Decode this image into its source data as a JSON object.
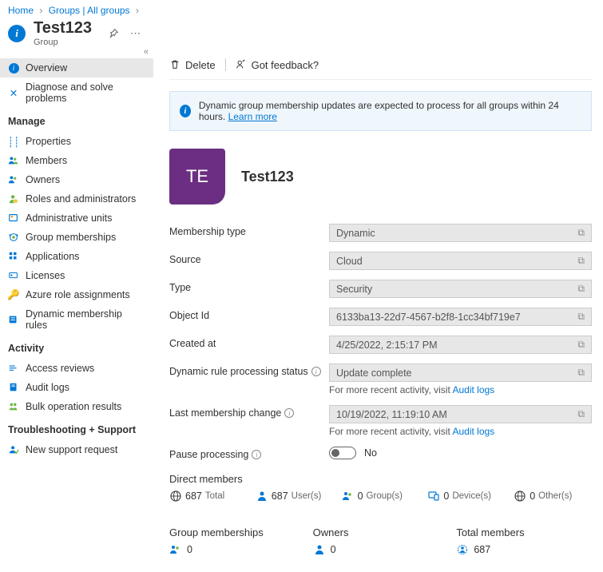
{
  "breadcrumb": {
    "home": "Home",
    "groups": "Groups | All groups"
  },
  "header": {
    "title": "Test123",
    "subtitle": "Group"
  },
  "sidebar": {
    "items": [
      {
        "label": "Overview"
      },
      {
        "label": "Diagnose and solve problems"
      }
    ],
    "manage_header": "Manage",
    "manage": [
      {
        "label": "Properties"
      },
      {
        "label": "Members"
      },
      {
        "label": "Owners"
      },
      {
        "label": "Roles and administrators"
      },
      {
        "label": "Administrative units"
      },
      {
        "label": "Group memberships"
      },
      {
        "label": "Applications"
      },
      {
        "label": "Licenses"
      },
      {
        "label": "Azure role assignments"
      },
      {
        "label": "Dynamic membership rules"
      }
    ],
    "activity_header": "Activity",
    "activity": [
      {
        "label": "Access reviews"
      },
      {
        "label": "Audit logs"
      },
      {
        "label": "Bulk operation results"
      }
    ],
    "support_header": "Troubleshooting + Support",
    "support": [
      {
        "label": "New support request"
      }
    ]
  },
  "toolbar": {
    "delete": "Delete",
    "feedback": "Got feedback?"
  },
  "notice": {
    "text": "Dynamic group membership updates are expected to process for all groups within 24 hours.",
    "link": "Learn more"
  },
  "hero": {
    "initials": "TE",
    "name": "Test123"
  },
  "props": {
    "membership_type": {
      "label": "Membership type",
      "value": "Dynamic"
    },
    "source": {
      "label": "Source",
      "value": "Cloud"
    },
    "type": {
      "label": "Type",
      "value": "Security"
    },
    "object_id": {
      "label": "Object Id",
      "value": "6133ba13-22d7-4567-b2f8-1cc34bf719e7"
    },
    "created_at": {
      "label": "Created at",
      "value": "4/25/2022, 2:15:17 PM"
    },
    "rule_status": {
      "label": "Dynamic rule processing status",
      "value": "Update complete",
      "note_prefix": "For more recent activity, visit ",
      "note_link": "Audit logs"
    },
    "last_change": {
      "label": "Last membership change",
      "value": "10/19/2022, 11:19:10 AM",
      "note_prefix": "For more recent activity, visit ",
      "note_link": "Audit logs"
    },
    "pause": {
      "label": "Pause processing",
      "value": "No"
    }
  },
  "direct_members": {
    "title": "Direct members",
    "total": {
      "count": "687",
      "label": "Total"
    },
    "users": {
      "count": "687",
      "label": "User(s)"
    },
    "groups": {
      "count": "0",
      "label": "Group(s)"
    },
    "devices": {
      "count": "0",
      "label": "Device(s)"
    },
    "others": {
      "count": "0",
      "label": "Other(s)"
    }
  },
  "bottom": {
    "group_memberships": {
      "title": "Group memberships",
      "count": "0"
    },
    "owners": {
      "title": "Owners",
      "count": "0"
    },
    "total_members": {
      "title": "Total members",
      "count": "687"
    }
  }
}
